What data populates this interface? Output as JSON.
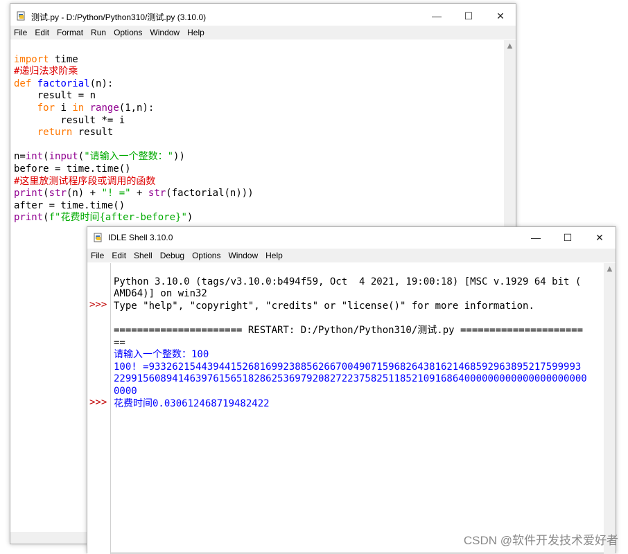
{
  "editor": {
    "title": "测试.py - D:/Python/Python310/测试.py (3.10.0)",
    "menu": [
      "File",
      "Edit",
      "Format",
      "Run",
      "Options",
      "Window",
      "Help"
    ],
    "code": {
      "l1_kw": "import",
      "l1_rest": " time",
      "l2": "#递归法求阶乘",
      "l3_kw": "def",
      "l3_name": "factorial",
      "l3_rest": "(n):",
      "l4": "    result = n",
      "l5_ind": "    ",
      "l5_for": "for",
      "l5_a": " i ",
      "l5_in": "in",
      "l5_sp": " ",
      "l5_range": "range",
      "l5_rest": "(1,n):",
      "l6": "        result *= i",
      "l7_ind": "    ",
      "l7_kw": "return",
      "l7_rest": " result",
      "l9_a": "n=",
      "l9_int": "int",
      "l9_b": "(",
      "l9_input": "input",
      "l9_c": "(",
      "l9_str": "\"请输入一个整数：\"",
      "l9_d": "))",
      "l10": "before = time.time()",
      "l11": "#这里放测试程序段或调用的函数",
      "l12_print": "print",
      "l12_a": "(",
      "l12_str1": "str",
      "l12_b": "(n) + ",
      "l12_lit": "\"! =\"",
      "l12_c": " + ",
      "l12_str2": "str",
      "l12_d": "(factorial(n)))",
      "l13": "after = time.time()",
      "l14_print": "print",
      "l14_a": "(",
      "l14_f": "f\"花费时间{after-before}\"",
      "l14_b": ")"
    }
  },
  "shell": {
    "title": "IDLE Shell 3.10.0",
    "menu": [
      "File",
      "Edit",
      "Shell",
      "Debug",
      "Options",
      "Window",
      "Help"
    ],
    "prompt": ">>>",
    "banner1": "Python 3.10.0 (tags/v3.10.0:b494f59, Oct  4 2021, 19:00:18) [MSC v.1929 64 bit (",
    "banner2": "AMD64)] on win32",
    "banner3": "Type \"help\", \"copyright\", \"credits\" or \"license()\" for more information.",
    "restart1": "====================== RESTART: D:/Python/Python310/测试.py =====================",
    "restart2": "==",
    "out1": "请输入一个整数：100",
    "out2": "100! =93326215443944152681699238856266700490715968264381621468592963895217599993",
    "out3": "229915608941463976156518286253697920827223758251185210916864000000000000000000000",
    "out4": "0000",
    "out5": "花费时间0.030612468719482422"
  },
  "window_controls": {
    "minimize": "—",
    "maximize": "☐",
    "close": "✕"
  },
  "watermark": "CSDN @软件开发技术爱好者"
}
